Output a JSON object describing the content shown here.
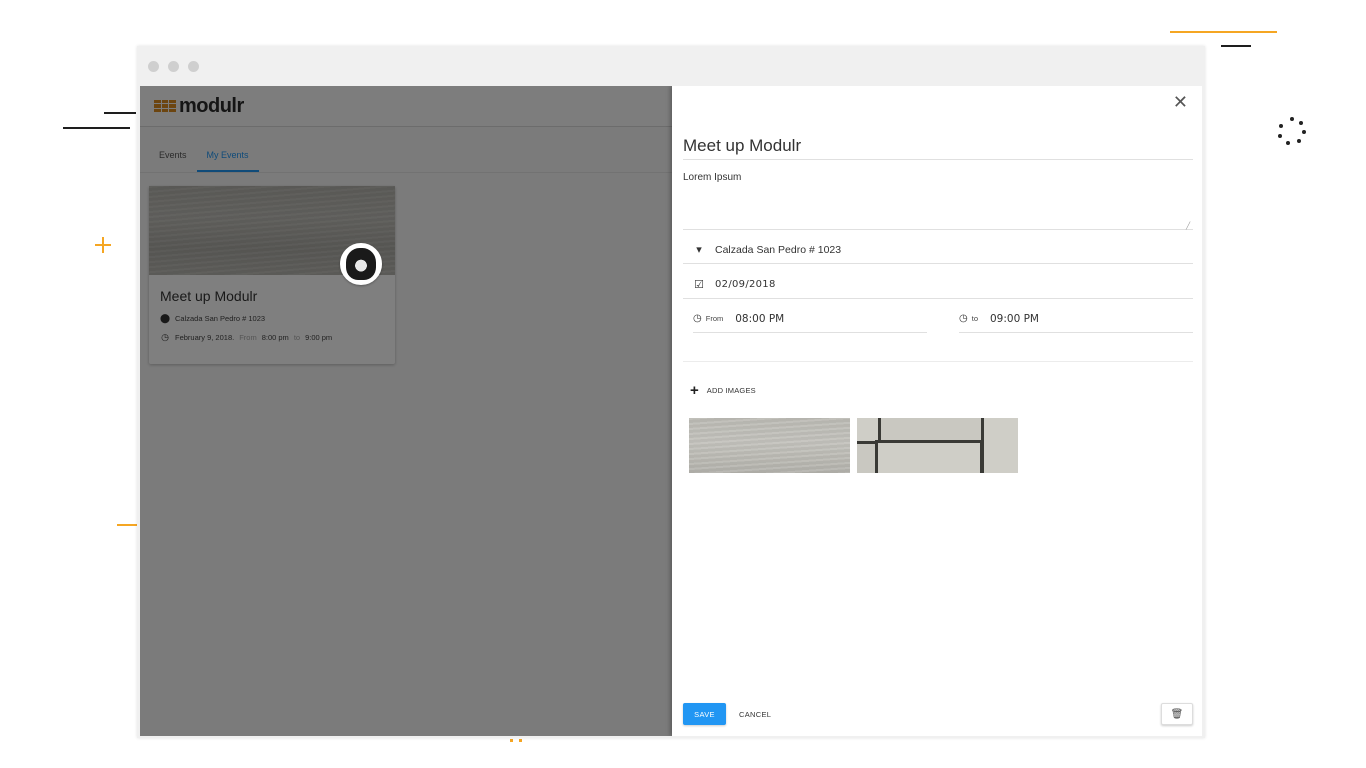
{
  "window": {
    "controls": [
      "close-dot",
      "minimize-dot",
      "maximize-dot"
    ]
  },
  "app": {
    "logo_text": "modulr",
    "tabs": [
      {
        "label": "Events",
        "active": false
      },
      {
        "label": "My Events",
        "active": true
      }
    ],
    "accent_color": "#2196f3",
    "card": {
      "title": "Meet up Modulr",
      "location": "Calzada San Pedro # 1023",
      "date": "February 9, 2018.",
      "from_label": "From",
      "from_time": "8:00 pm",
      "to_label": "to",
      "to_time": "9:00 pm"
    }
  },
  "drawer": {
    "close_icon": "close-icon",
    "title": "Meet up Modulr",
    "description": "Lorem Ipsum",
    "location": "Calzada San Pedro # 1023",
    "date": "02/09/2018",
    "from_label": "From",
    "from_time": "08:00 PM",
    "to_label": "to",
    "to_time": "09:00 PM",
    "add_images_label": "ADD IMAGES",
    "images": [
      "water-photo",
      "tiles-photo"
    ],
    "save_label": "SAVE",
    "cancel_label": "CANCEL",
    "delete_icon": "trash-icon"
  }
}
